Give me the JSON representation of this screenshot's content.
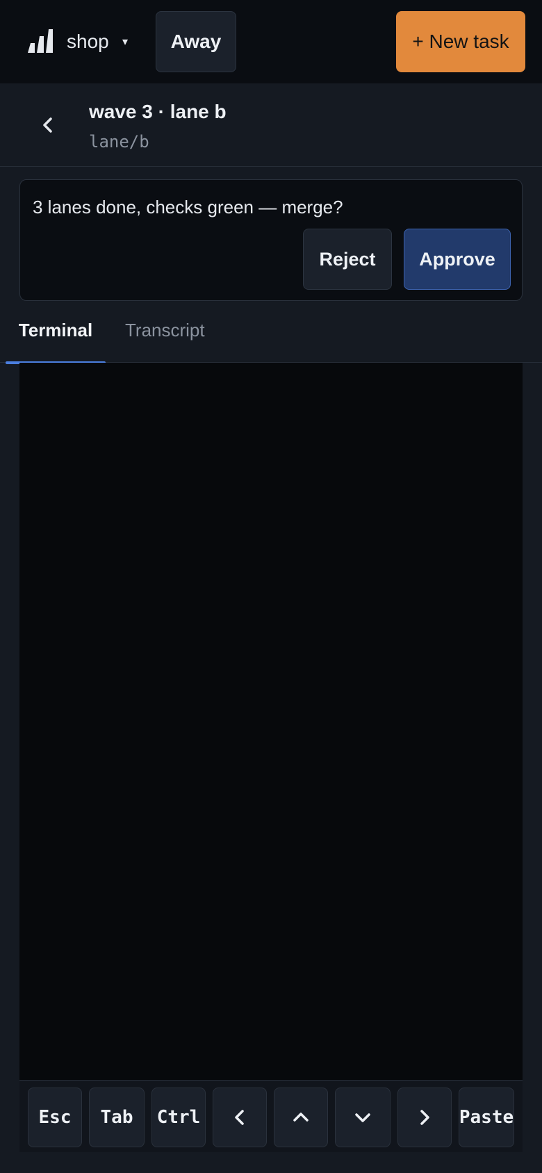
{
  "topbar": {
    "workspace": "shop",
    "workspace_caret": "▾",
    "status_button": "Away",
    "new_task_button": "+ New task",
    "accent_color": "#e2893c"
  },
  "header": {
    "back_icon": "chevron-left-icon",
    "title": "wave 3 · lane b",
    "branch": "lane/b"
  },
  "approval": {
    "message": "3 lanes done, checks green — merge?",
    "reject_label": "Reject",
    "approve_label": "Approve",
    "approve_color": "#223a6b"
  },
  "tabs": [
    {
      "label": "Terminal",
      "active": true
    },
    {
      "label": "Transcript",
      "active": false
    }
  ],
  "keybar": {
    "esc": "Esc",
    "tab": "Tab",
    "ctrl": "Ctrl",
    "left_icon": "arrow-left-icon",
    "up_icon": "arrow-up-icon",
    "down_icon": "arrow-down-icon",
    "right_icon": "arrow-right-icon",
    "paste": "Paste"
  }
}
